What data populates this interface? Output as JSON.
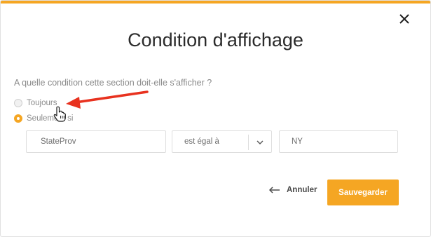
{
  "dialog": {
    "title": "Condition d'affichage",
    "close_icon": "close-icon",
    "accent_color": "#f5a623"
  },
  "question": "A quelle condition cette section doit-elle s'afficher ?",
  "options": [
    {
      "label": "Toujours",
      "checked": false
    },
    {
      "label": "Seulement si",
      "checked": true
    }
  ],
  "condition": {
    "field_value": "StateProv",
    "operator_value": "est égal à",
    "operator_icon": "chevron-down-icon",
    "compare_value": "NY"
  },
  "footer": {
    "cancel_label": "Annuler",
    "cancel_icon": "arrow-left-icon",
    "save_label": "Sauvegarder"
  },
  "annotation": {
    "arrow_color": "#e8321f",
    "cursor_icon": "hand-pointer-icon"
  }
}
